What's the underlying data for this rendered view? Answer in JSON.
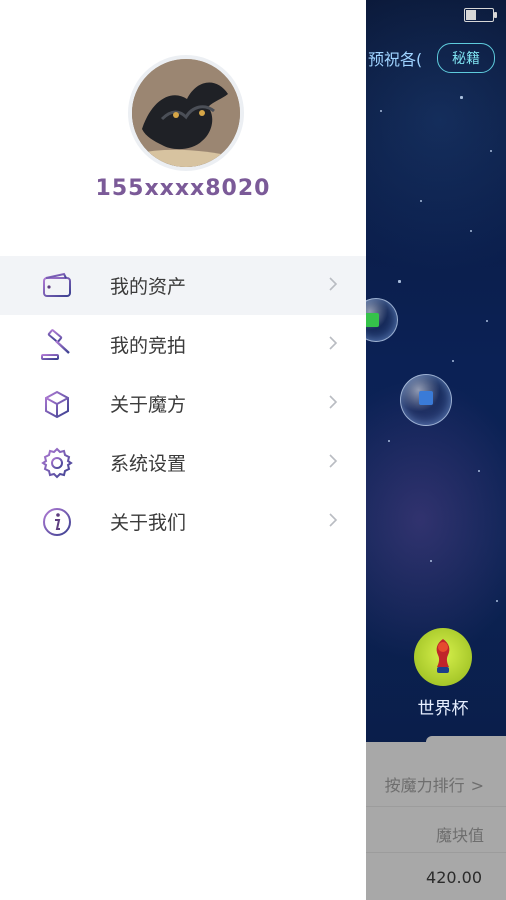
{
  "drawer": {
    "user_phone": "155xxxx8020",
    "menu": [
      {
        "label": "我的资产",
        "icon": "wallet-icon",
        "active": true
      },
      {
        "label": "我的竞拍",
        "icon": "auction-gavel-icon",
        "active": false
      },
      {
        "label": "关于魔方",
        "icon": "cube-icon",
        "active": false
      },
      {
        "label": "系统设置",
        "icon": "gear-icon",
        "active": false
      },
      {
        "label": "关于我们",
        "icon": "info-icon",
        "active": false
      }
    ]
  },
  "background": {
    "marquee_text": "预祝各(",
    "secret_button": "秘籍",
    "worldcup_label": "世界杯",
    "bottom_panel": {
      "rank_link": "按魔力排行",
      "rank_chevron": ">",
      "cube_value_label": "魔块值",
      "cube_value": "420.00"
    }
  },
  "colors": {
    "accent_purple": "#7b5a98",
    "icon_purple": "#5e3d7f",
    "bubble_green": "#35c24a",
    "bubble_blue": "#3a7bd8"
  }
}
